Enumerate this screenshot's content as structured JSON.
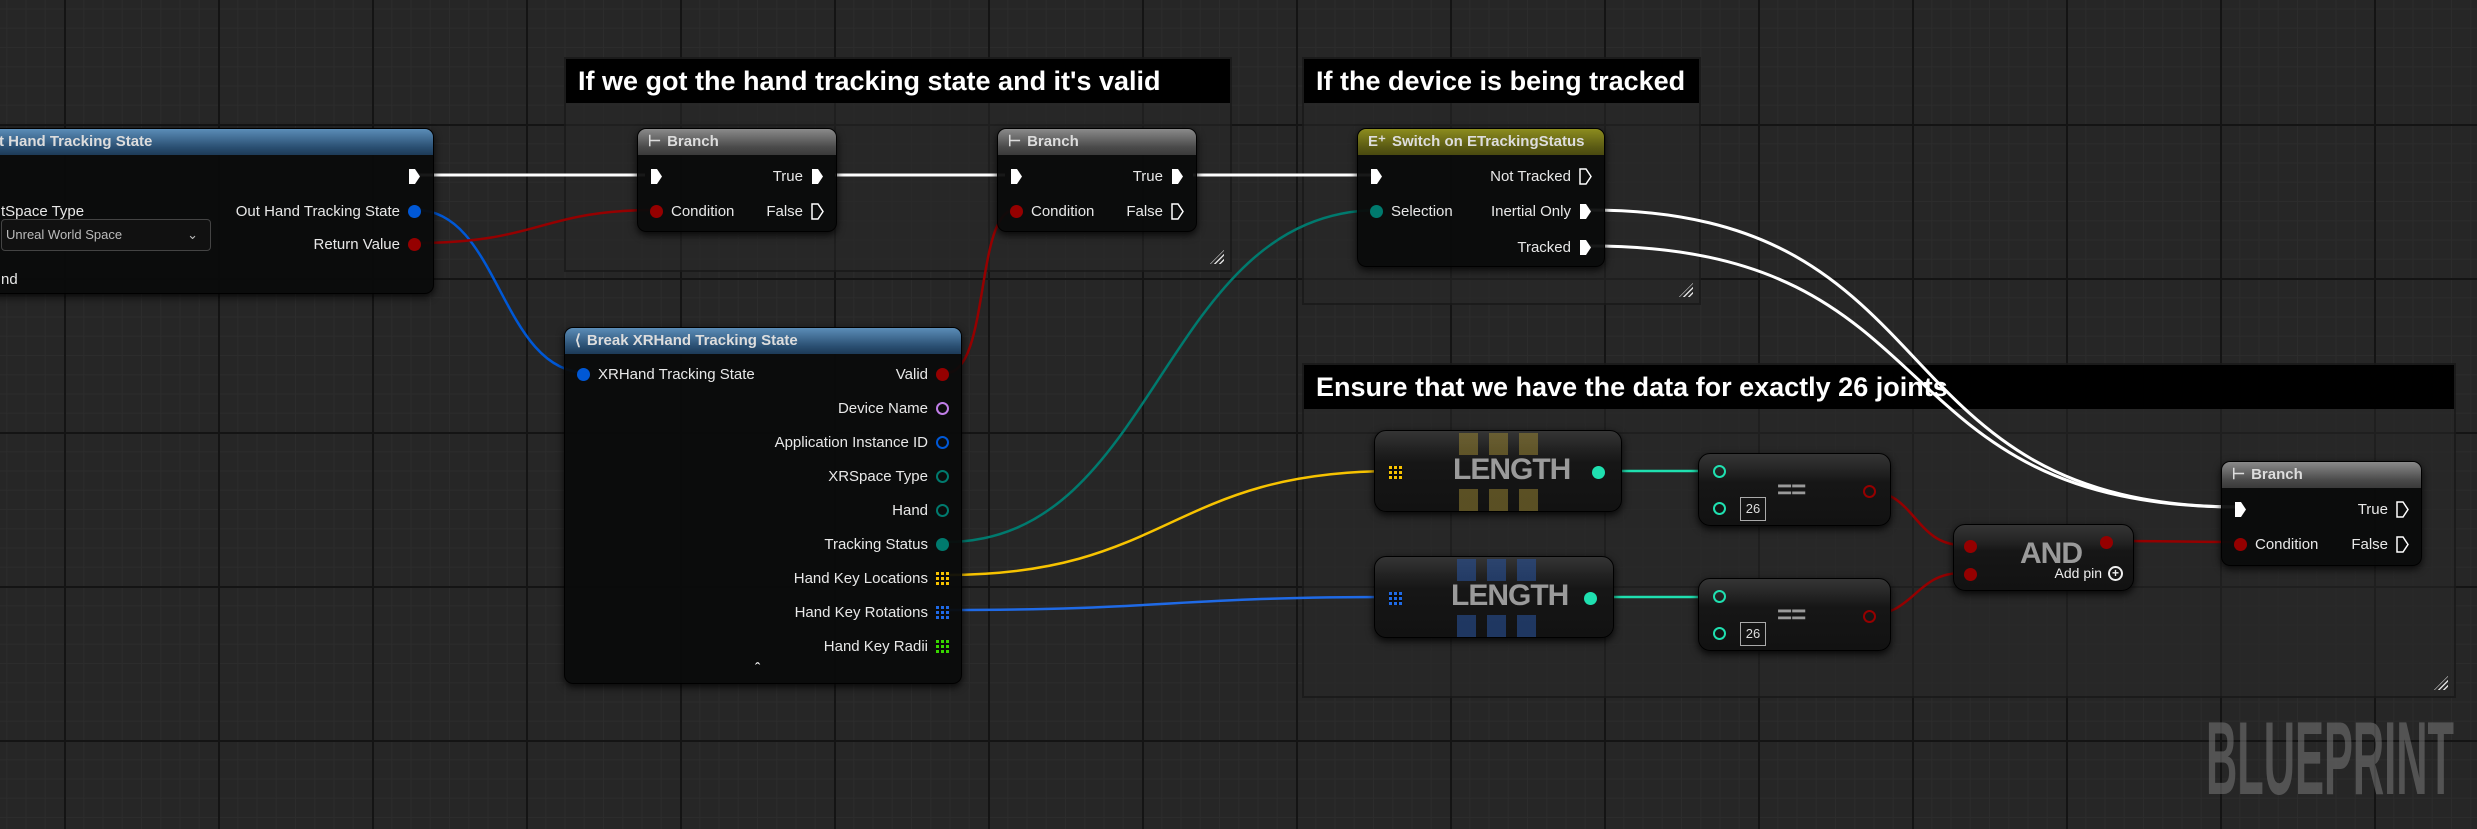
{
  "comments": [
    {
      "title": "If we got the hand tracking state and it's valid"
    },
    {
      "title": "If the device is being tracked"
    },
    {
      "title": "Ensure that we have the data for exactly 26 joints"
    }
  ],
  "get_node": {
    "title": "t Hand Tracking State",
    "space_label": "tSpace Type",
    "space_value": "Unreal World Space",
    "hand_label": "nd",
    "out_state": "Out Hand Tracking State",
    "return_value": "Return Value"
  },
  "branch1": {
    "title": "Branch",
    "true": "True",
    "false": "False",
    "condition": "Condition"
  },
  "branch2": {
    "title": "Branch",
    "true": "True",
    "false": "False",
    "condition": "Condition"
  },
  "branch3": {
    "title": "Branch",
    "true": "True",
    "false": "False",
    "condition": "Condition"
  },
  "switch_node": {
    "title": "Switch on ETrackingStatus",
    "selection": "Selection",
    "outputs": [
      "Not Tracked",
      "Inertial Only",
      "Tracked"
    ]
  },
  "break_node": {
    "title": "Break XRHand Tracking State",
    "input": "XRHand Tracking State",
    "outputs": [
      "Valid",
      "Device Name",
      "Application Instance ID",
      "XRSpace Type",
      "Hand",
      "Tracking Status",
      "Hand Key Locations",
      "Hand Key Rotations",
      "Hand Key Radii"
    ]
  },
  "length1": {
    "label": "LENGTH"
  },
  "length2": {
    "label": "LENGTH"
  },
  "equal1": {
    "op": "==",
    "value": "26"
  },
  "equal2": {
    "op": "==",
    "value": "26"
  },
  "and_node": {
    "label": "AND",
    "add_pin": "Add pin"
  },
  "watermark": "BLUEPRINT",
  "colors": {
    "exec": "#ffffff",
    "bool": "#950000",
    "struct": "#0058d6",
    "name": "#c07ee8",
    "enum": "#007a6e",
    "int": "#1fe0b0",
    "vector": "#f7c300",
    "rotator": "#1f6ae6",
    "float": "#38d600"
  }
}
